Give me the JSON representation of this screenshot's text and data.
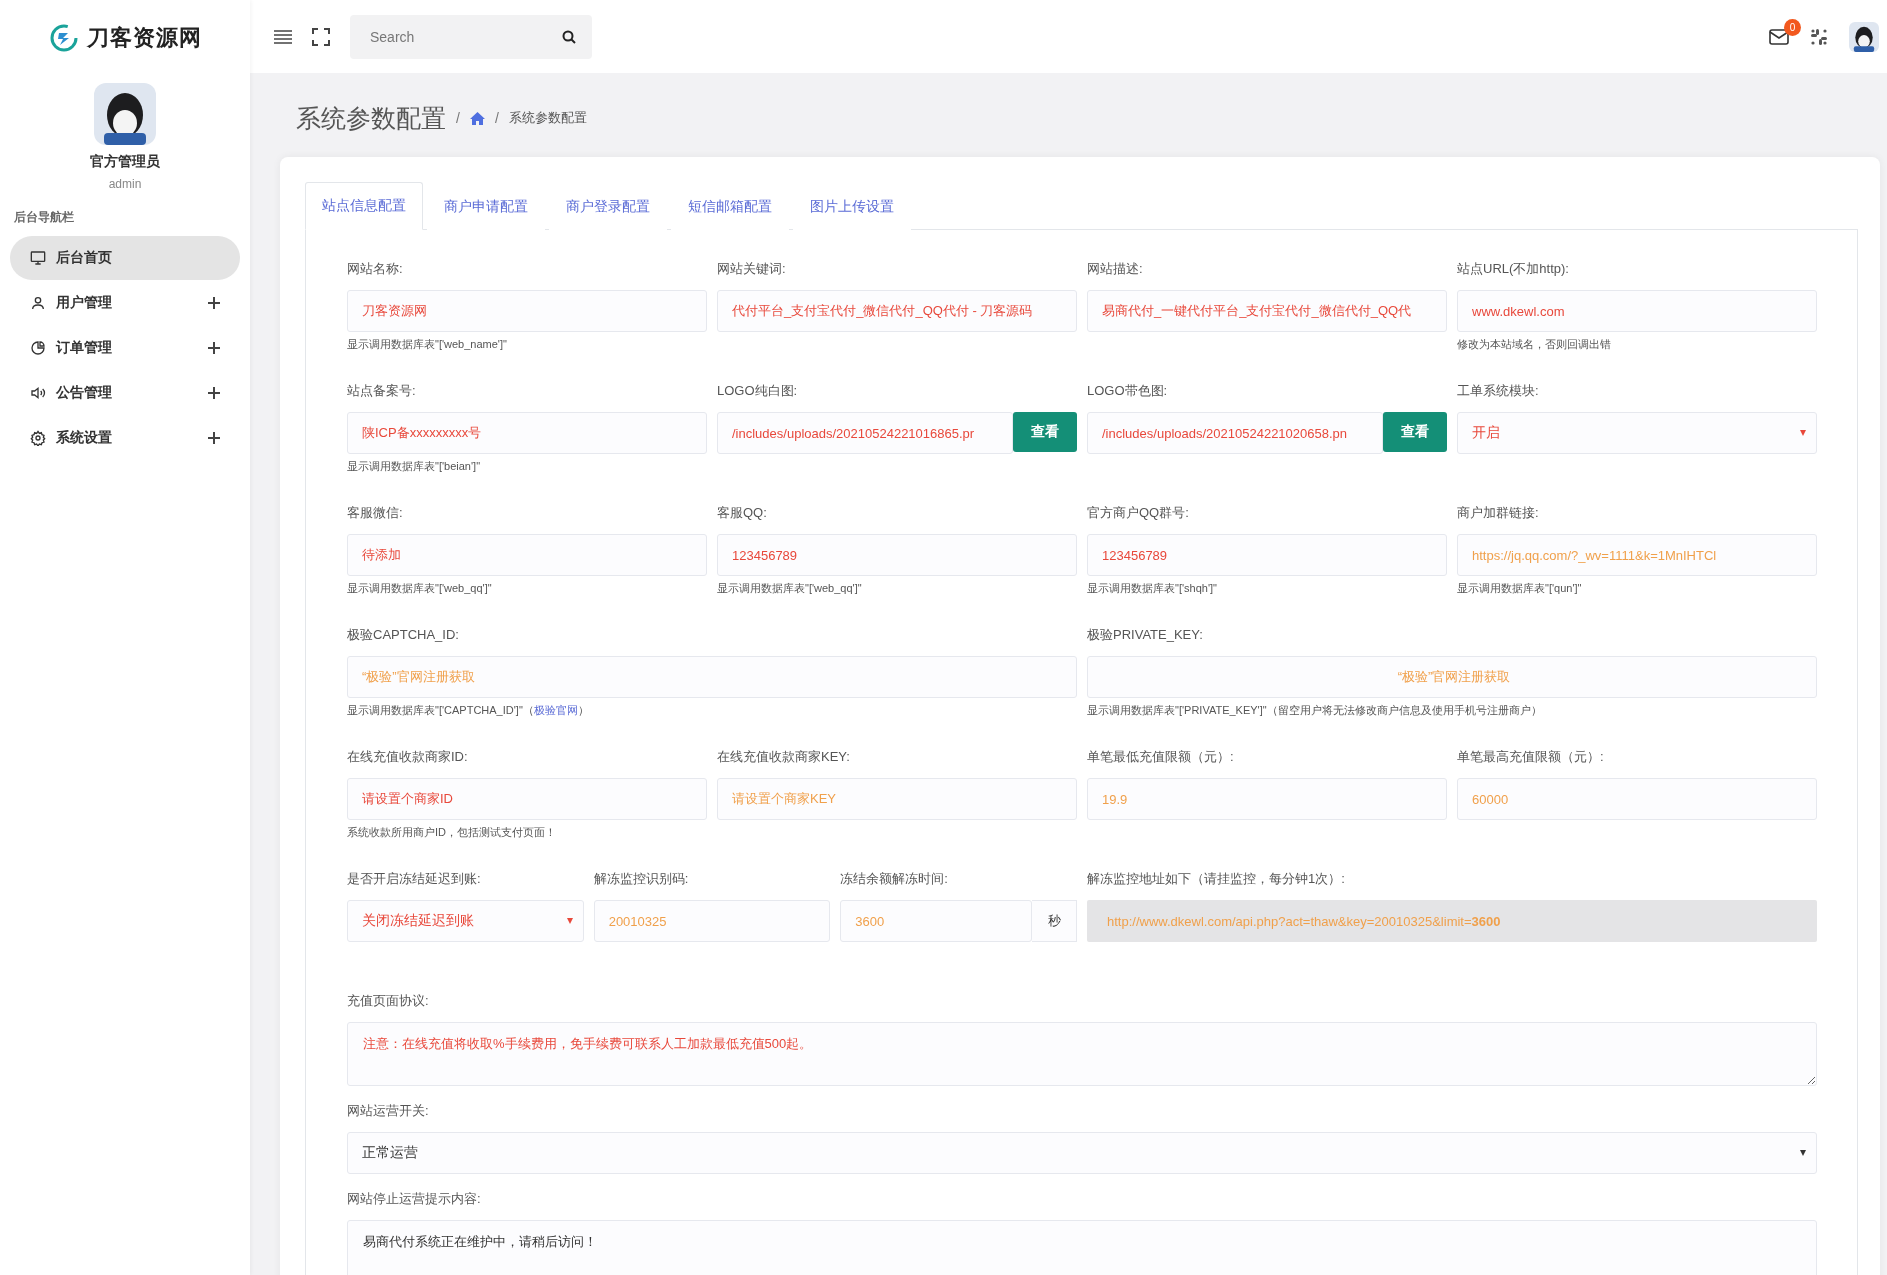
{
  "brand": {
    "name": "刀客资源网"
  },
  "user": {
    "name": "官方管理员",
    "role": "admin"
  },
  "nav_heading": "后台导航栏",
  "nav": [
    {
      "label": "后台首页",
      "kind": "monitor",
      "selected": true,
      "has_children": false
    },
    {
      "label": "用户管理",
      "kind": "user",
      "selected": false,
      "has_children": true
    },
    {
      "label": "订单管理",
      "kind": "orders",
      "selected": false,
      "has_children": true
    },
    {
      "label": "公告管理",
      "kind": "notice",
      "selected": false,
      "has_children": true
    },
    {
      "label": "系统设置",
      "kind": "settings",
      "selected": false,
      "has_children": true
    }
  ],
  "search": {
    "placeholder": "Search"
  },
  "notifications": {
    "count": "0"
  },
  "page_title": "系统参数配置",
  "breadcrumb": [
    {
      "kind": "separator",
      "text": "/"
    },
    {
      "kind": "home"
    },
    {
      "kind": "separator",
      "text": "/"
    },
    {
      "kind": "current",
      "text": "系统参数配置"
    }
  ],
  "tabs": [
    {
      "label": "站点信息配置",
      "selected": true
    },
    {
      "label": "商户申请配置",
      "selected": false
    },
    {
      "label": "商户登录配置",
      "selected": false
    },
    {
      "label": "短信邮箱配置",
      "selected": false
    },
    {
      "label": "图片上传设置",
      "selected": false
    }
  ],
  "rows": [
    {
      "fields": [
        {
          "label": "网站名称:",
          "kind": "input",
          "value": "刀客资源网",
          "color": "#e8483b",
          "help": "显示调用数据库表\"['web_name']\""
        },
        {
          "label": "网站关键词:",
          "kind": "input",
          "value": "代付平台_支付宝代付_微信代付_QQ代付 - 刀客源码",
          "color": "#e8483b"
        },
        {
          "label": "网站描述:",
          "kind": "input",
          "value": "易商代付_一键代付平台_支付宝代付_微信代付_QQ代",
          "color": "#e8483b"
        },
        {
          "label": "站点URL(不加http):",
          "kind": "input",
          "value": "www.dkewl.com",
          "color": "#e8483b",
          "help": "修改为本站域名，否则回调出错"
        }
      ]
    },
    {
      "fields": [
        {
          "label": "站点备案号:",
          "kind": "input",
          "value": "陕ICP备xxxxxxxxx号",
          "color": "#e8483b",
          "help": "显示调用数据库表\"['beian']\""
        },
        {
          "label": "LOGO纯白图:",
          "kind": "input_button",
          "value": "/includes/uploads/20210524221016865.pr",
          "color": "#e8483b",
          "button": "查看"
        },
        {
          "label": "LOGO带色图:",
          "kind": "input_button",
          "value": "/includes/uploads/20210524221020658.pn",
          "color": "#e8483b",
          "button": "查看"
        },
        {
          "label": "工单系统模块:",
          "kind": "select",
          "value": "开启",
          "color": "#e8483b"
        }
      ]
    },
    {
      "fields": [
        {
          "label": "客服微信:",
          "kind": "input",
          "value": "待添加",
          "color": "#e8483b",
          "help": "显示调用数据库表\"['web_qq']\""
        },
        {
          "label": "客服QQ:",
          "kind": "input",
          "value": "123456789",
          "color": "#e8483b",
          "help": "显示调用数据库表\"['web_qq']\""
        },
        {
          "label": "官方商户QQ群号:",
          "kind": "input",
          "value": "123456789",
          "color": "#e8483b",
          "help": "显示调用数据库表\"['shqh']\""
        },
        {
          "label": "商户加群链接:",
          "kind": "input",
          "value": "https://jq.qq.com/?_wv=1111&k=1MnIHTCl",
          "color": "#f0a04b",
          "help": "显示调用数据库表\"['qun']\""
        }
      ]
    },
    {
      "fields": [
        {
          "label": "极验CAPTCHA_ID:",
          "kind": "input",
          "value": "“极验”官网注册获取",
          "color": "#f0a04b",
          "help": "显示调用数据库表\"['CAPTCHA_ID']\"（",
          "help_link": "极验官网",
          "help_after": "）"
        },
        {
          "label": "极验PRIVATE_KEY:",
          "kind": "input_centered",
          "value": "“极验”官网注册获取",
          "color": "#f0a04b",
          "help": "显示调用数据库表\"['PRIVATE_KEY']\"（留空用户将无法修改商户信息及使用手机号注册商户）"
        }
      ]
    },
    {
      "fields": [
        {
          "label": "在线充值收款商家ID:",
          "kind": "input",
          "value": "请设置个商家ID",
          "color": "#e8483b",
          "help": "系统收款所用商户ID，包括测试支付页面！"
        },
        {
          "label": "在线充值收款商家KEY:",
          "kind": "input",
          "value": "请设置个商家KEY",
          "color": "#f0a04b"
        },
        {
          "label": "单笔最低充值限额（元）:",
          "kind": "input",
          "value": "19.9",
          "color": "#f0a04b"
        },
        {
          "label": "单笔最高充值限额（元）:",
          "kind": "input",
          "value": "60000",
          "color": "#f0a04b"
        }
      ]
    },
    {
      "fields": [
        {
          "label": "是否开启冻结延迟到账:",
          "kind": "select",
          "value": "关闭冻结延迟到账",
          "color": "#e8483b"
        },
        {
          "label": "解冻监控识别码:",
          "kind": "input",
          "value": "20010325",
          "color": "#f0a04b"
        },
        {
          "label": "冻结余额解冻时间:",
          "kind": "input_addon",
          "value": "3600",
          "color": "#f0a04b",
          "addon": "秒"
        },
        {
          "label": "解冻监控地址如下（请挂监控，每分钟1次）:",
          "kind": "readonly",
          "value": "http://www.dkewl.com/api.php?act=thaw&key=20010325&limit=**3600**",
          "color": "#f0a04b"
        }
      ]
    },
    {
      "fields": [
        {
          "label": "充值页面协议:",
          "kind": "textarea",
          "value": "注意：在线充值将收取%手续费用，免手续费可联系人工加款最低充值500起。",
          "color": "#e8483b"
        }
      ]
    },
    {
      "fields": [
        {
          "label": "网站运营开关:",
          "kind": "select",
          "value": "正常运营"
        }
      ]
    },
    {
      "fields": [
        {
          "label": "网站停止运营提示内容:",
          "kind": "textarea",
          "value": "易商代付系统正在维护中，请稍后访问！"
        }
      ]
    }
  ]
}
